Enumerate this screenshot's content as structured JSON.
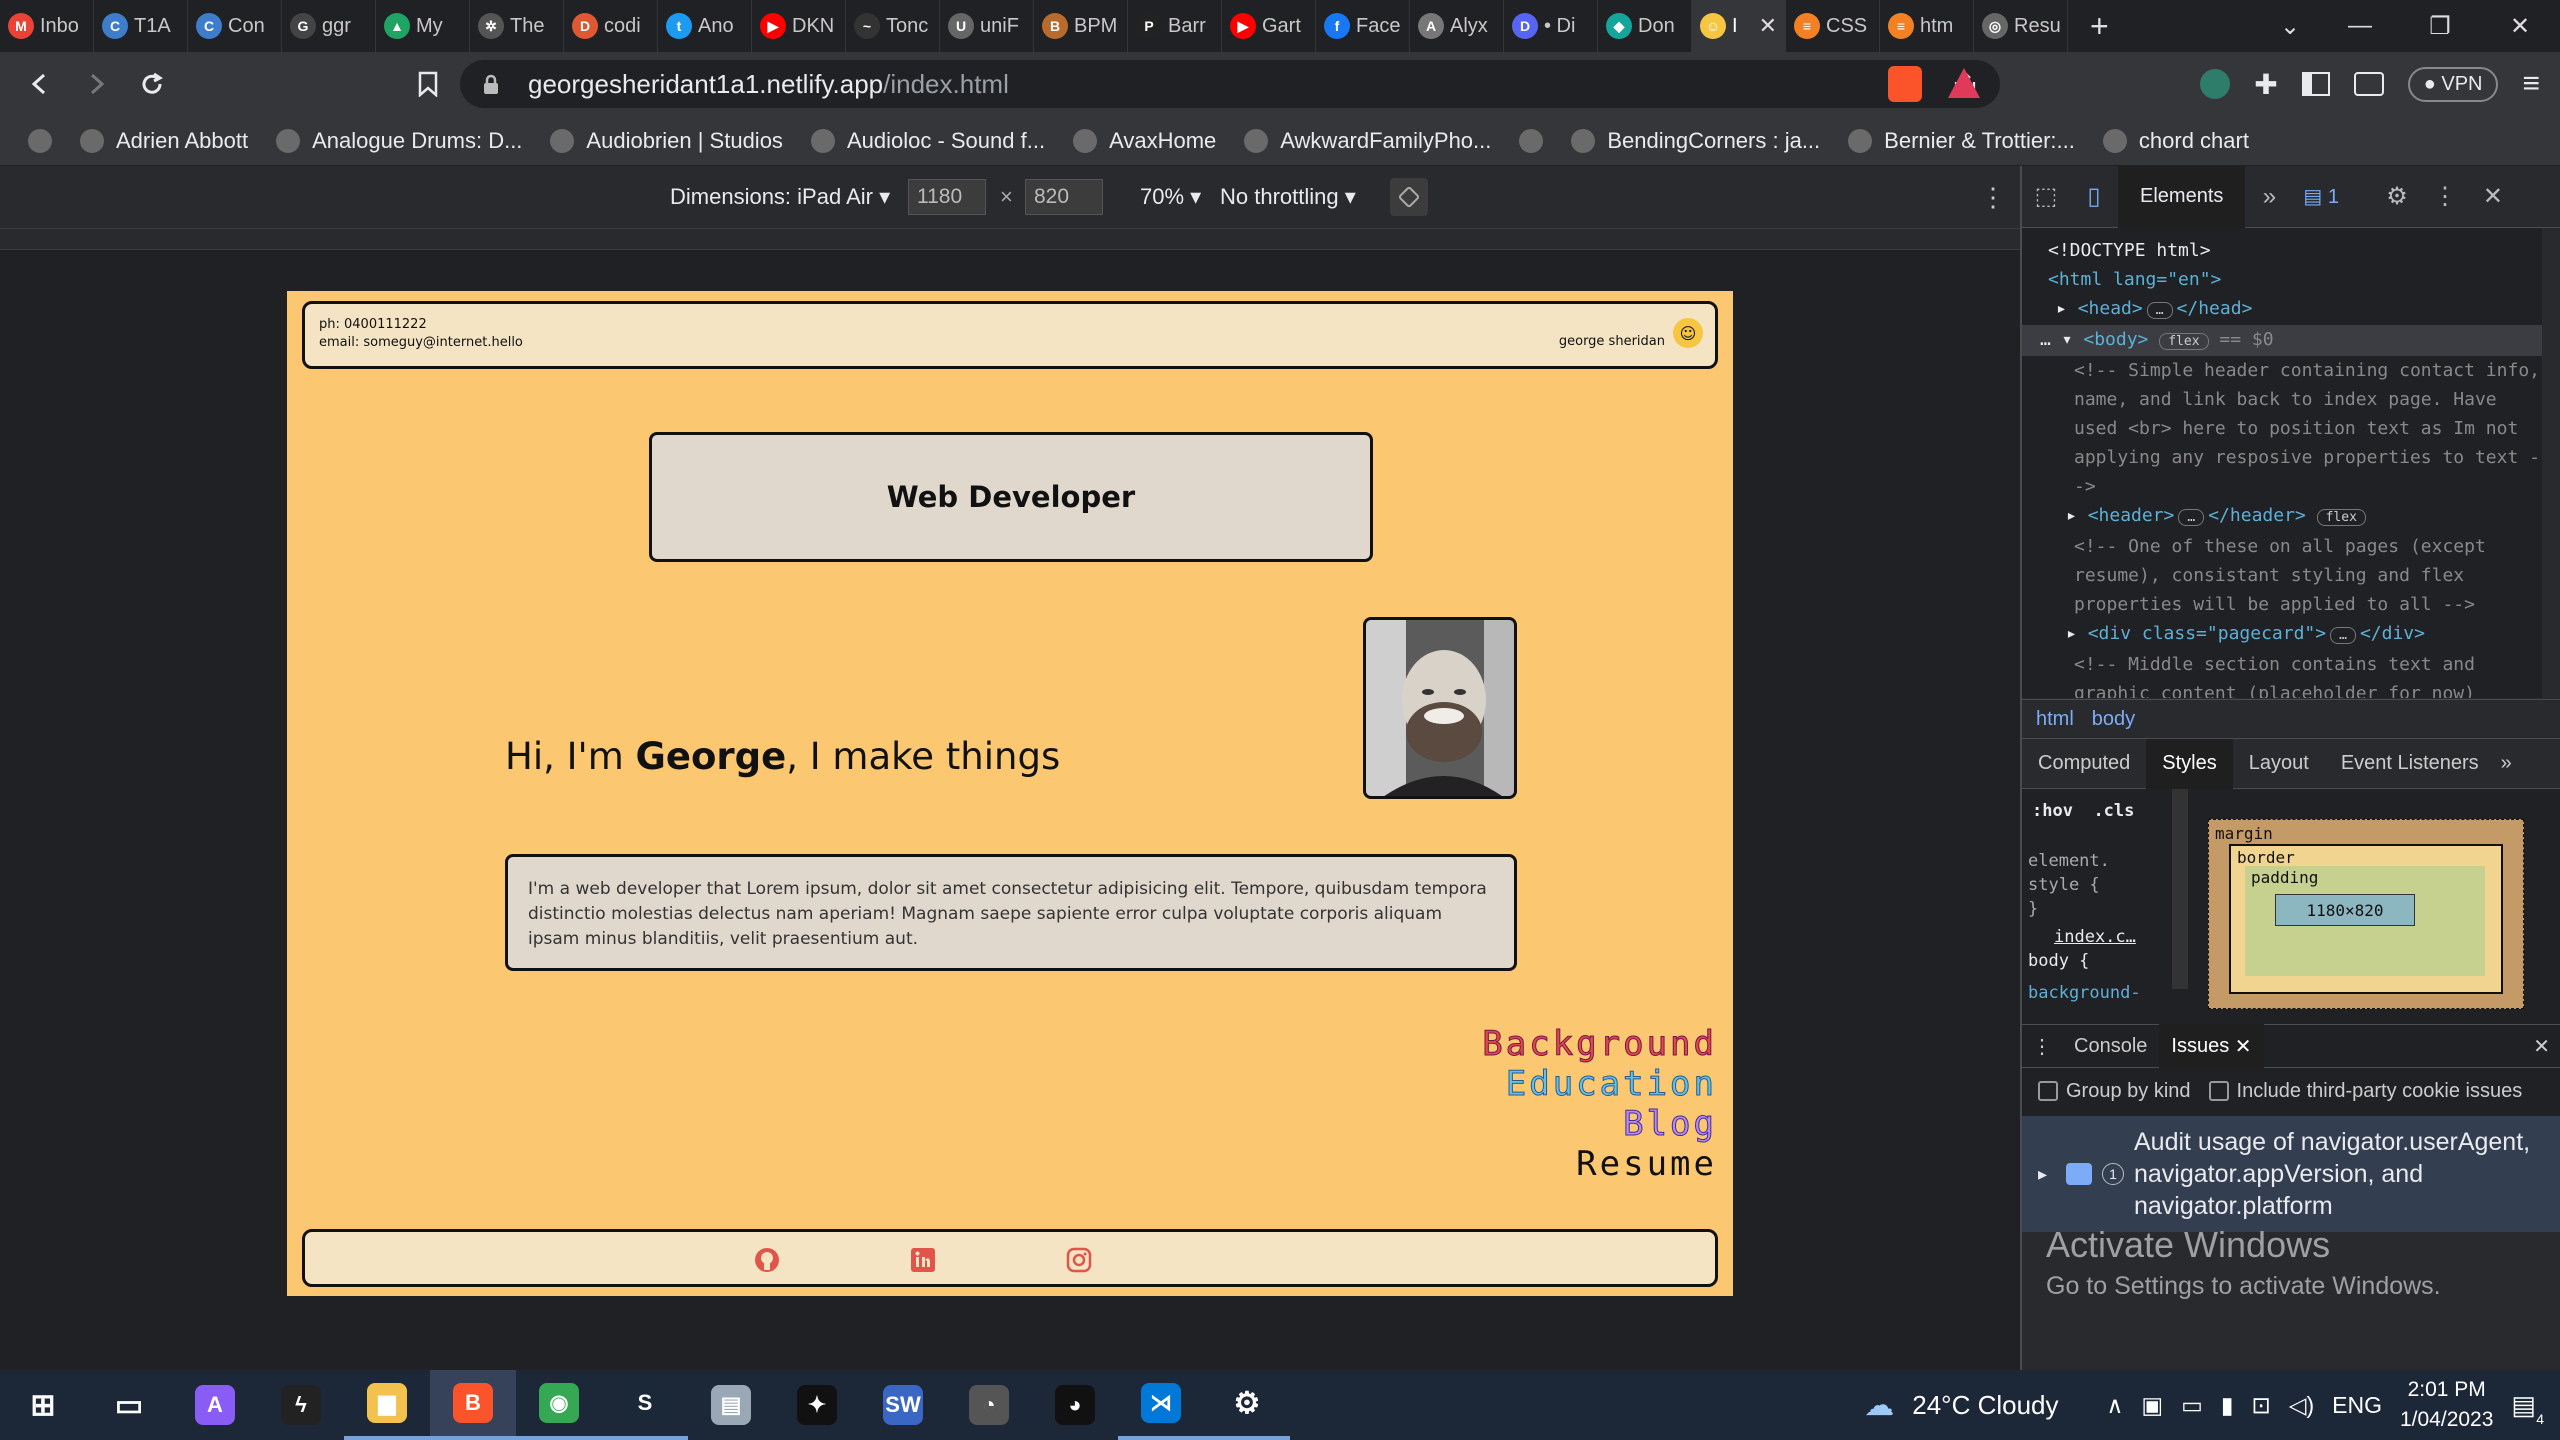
{
  "browser": {
    "tabs": [
      {
        "label": "Inbo",
        "icon": "gmail-icon",
        "color": "#ea4335",
        "glyph": "M"
      },
      {
        "label": "T1A",
        "icon": "canvas-icon",
        "color": "#3d7dca",
        "glyph": "C"
      },
      {
        "label": "Con",
        "icon": "canvas-icon",
        "color": "#3d7dca",
        "glyph": "C"
      },
      {
        "label": "ggr",
        "icon": "github-icon",
        "color": "#444444",
        "glyph": "G"
      },
      {
        "label": "My",
        "icon": "drive-icon",
        "color": "#1fa463",
        "glyph": "▲"
      },
      {
        "label": "The",
        "icon": "openai-icon",
        "color": "#555555",
        "glyph": "✲"
      },
      {
        "label": "codi",
        "icon": "duckduckgo-icon",
        "color": "#de5833",
        "glyph": "D"
      },
      {
        "label": "Ano",
        "icon": "twitter-icon",
        "color": "#1d9bf0",
        "glyph": "t"
      },
      {
        "label": "DKN",
        "icon": "youtube-icon",
        "color": "#ff0000",
        "glyph": "▶"
      },
      {
        "label": "Tonc",
        "icon": "generic-icon",
        "color": "#333333",
        "glyph": "~"
      },
      {
        "label": "uniF",
        "icon": "uni-icon",
        "color": "#666666",
        "glyph": "U"
      },
      {
        "label": "BPM",
        "icon": "bpm-icon",
        "color": "#b96b2d",
        "glyph": "B"
      },
      {
        "label": "Barr",
        "icon": "patreon-icon",
        "color": "#222222",
        "glyph": "P"
      },
      {
        "label": "Gart",
        "icon": "youtube-icon",
        "color": "#ff0000",
        "glyph": "▶"
      },
      {
        "label": "Face",
        "icon": "facebook-icon",
        "color": "#1877f2",
        "glyph": "f"
      },
      {
        "label": "Alyx",
        "icon": "image-icon",
        "color": "#777777",
        "glyph": "A"
      },
      {
        "label": "• Di",
        "icon": "discord-icon",
        "color": "#5865f2",
        "glyph": "D"
      },
      {
        "label": "Don",
        "icon": "diamond-icon",
        "color": "#15a59b",
        "glyph": "◆"
      }
    ],
    "active_tab": {
      "label": "I",
      "icon": "emoji-icon",
      "color": "#f6c642",
      "glyph": "☺"
    },
    "tabs_after": [
      {
        "label": "CSS",
        "icon": "stackoverflow-icon",
        "color": "#f48024",
        "glyph": "≡"
      },
      {
        "label": "htm",
        "icon": "stackoverflow-icon",
        "color": "#f48024",
        "glyph": "≡"
      },
      {
        "label": "Resu",
        "icon": "globe-icon",
        "color": "#666666",
        "glyph": "◎"
      }
    ],
    "url_domain": "georgesheridant1a1.netlify.app",
    "url_path": "/index.html",
    "vpn_label": "VPN",
    "bookmarks": [
      {
        "label": "",
        "icon": "globe-icon"
      },
      {
        "label": "Adrien Abbott",
        "icon": "aa-icon"
      },
      {
        "label": "Analogue Drums: D...",
        "icon": "ad-icon"
      },
      {
        "label": "Audiobrien | Studios",
        "icon": "globe-icon"
      },
      {
        "label": "Audioloc - Sound f...",
        "icon": "audioloc-icon"
      },
      {
        "label": "AvaxHome",
        "icon": "globe-icon"
      },
      {
        "label": "AwkwardFamilyPho...",
        "icon": "afp-icon"
      },
      {
        "label": "",
        "icon": "globe-icon"
      },
      {
        "label": "BendingCorners : ja...",
        "icon": "bc-icon"
      },
      {
        "label": "Bernier & Trottier:...",
        "icon": "bt-icon"
      },
      {
        "label": "chord chart",
        "icon": "globe-icon"
      }
    ]
  },
  "device_toolbar": {
    "dimensions_label": "Dimensions: iPad Air",
    "width": "1180",
    "height": "820",
    "times": "×",
    "zoom": "70%",
    "throttle": "No throttling"
  },
  "site": {
    "phone": "ph: 0400111222",
    "email": "email: someguy@internet.hello",
    "owner_name": "george sheridan",
    "title": "Web Developer",
    "hero_prefix": "Hi, I'm ",
    "hero_name": "George",
    "hero_suffix": ", I make things",
    "bio": "I'm a web developer that Lorem ipsum, dolor sit amet consectetur adipisicing elit. Tempore, quibusdam tempora distinctio molestias delectus nam aperiam! Magnam saepe sapiente error culpa voluptate corporis aliquam ipsam minus blanditiis, velit praesentium aut.",
    "links": [
      "Background",
      "Education",
      "Blog",
      "Resume"
    ],
    "colors": {
      "page_bg": "#fbc770",
      "card_bg": "#e0d8cc",
      "header_bg": "#f4e4c4",
      "footer_icons": "#e0544a"
    }
  },
  "devtools": {
    "tab_elements": "Elements",
    "issues_count": "1",
    "dom": {
      "doctype": "<!DOCTYPE html>",
      "html_open": "<html lang=\"en\">",
      "head": "<head>",
      "head_close": "</head>",
      "body": "<body>",
      "body_badge": "flex",
      "body_eq": "== $0",
      "comment1": "<!-- Simple header containing contact info, name, and link back to index page. Have used <br> here to position text as Im not applying any resposive properties to text -->",
      "header": "<header>",
      "header_close": "</header>",
      "header_badge": "flex",
      "comment2": "<!-- One of these on all pages (except resume), consistant styling and flex properties will be applied to all  -->",
      "pagecard": "<div class=\"pagecard\">",
      "div_close": "</div>",
      "comment3": "<!-- Middle section contains text and graphic content (placeholder for now)"
    },
    "crumbs": [
      "html",
      "body"
    ],
    "style_tabs": [
      "Computed",
      "Styles",
      "Layout",
      "Event Listeners"
    ],
    "style_tab_selected": "Styles",
    "filter_hov": ":hov",
    "filter_cls": ".cls",
    "styles": {
      "element_style": "element.",
      "element_style2": "style {",
      "close_brace": "}",
      "source": "index.c…",
      "selector": "body {",
      "prop": "background-"
    },
    "box_model": {
      "margin": "margin",
      "border": "border",
      "padding": "padding",
      "content": "1180×820",
      "dash": "–"
    },
    "drawer_tabs": [
      "Console",
      "Issues"
    ],
    "drawer_selected": "Issues",
    "group_by_kind": "Group by kind",
    "third_party": "Include third-party cookie issues",
    "issue_count": "1",
    "issue_text": "Audit usage of navigator.userAgent, navigator.appVersion, and navigator.platform",
    "activate_title": "Activate Windows",
    "activate_sub": "Go to Settings to activate Windows."
  },
  "taskbar": {
    "weather": "24°C  Cloudy",
    "language": "ENG",
    "time": "2:01 PM",
    "date": "1/04/2023",
    "notifications": "4",
    "apps": [
      {
        "name": "start-icon",
        "color": "transparent",
        "glyph": "⊞"
      },
      {
        "name": "task-view-icon",
        "color": "transparent",
        "glyph": "▭"
      },
      {
        "name": "arc-icon",
        "color": "#8a5cf6",
        "glyph": "A"
      },
      {
        "name": "bolt-icon",
        "color": "#222222",
        "glyph": "ϟ"
      },
      {
        "name": "file-explorer-icon",
        "color": "#f2c14e",
        "glyph": "▆"
      },
      {
        "name": "brave-icon",
        "color": "#fb542b",
        "glyph": "B"
      },
      {
        "name": "chrome-icon",
        "color": "#34a853",
        "glyph": "◉"
      },
      {
        "name": "steam-icon",
        "color": "#1b2838",
        "glyph": "S"
      },
      {
        "name": "folder-network-icon",
        "color": "#9aa7b5",
        "glyph": "▤"
      },
      {
        "name": "tidal-icon",
        "color": "#111111",
        "glyph": "✦"
      },
      {
        "name": "sw-icon",
        "color": "#3a66c4",
        "glyph": "SW"
      },
      {
        "name": "disk-icon",
        "color": "#555555",
        "glyph": "◔"
      },
      {
        "name": "penguin-icon",
        "color": "#111111",
        "glyph": "◕"
      },
      {
        "name": "vscode-icon",
        "color": "#0078d7",
        "glyph": "⋊"
      },
      {
        "name": "settings-icon",
        "color": "transparent",
        "glyph": "⚙"
      }
    ]
  }
}
